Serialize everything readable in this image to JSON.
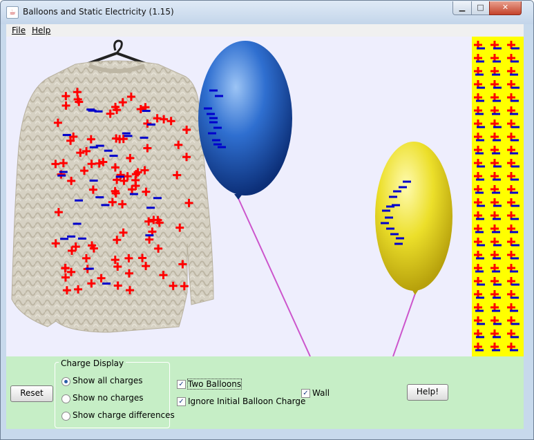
{
  "window": {
    "title": "Balloons and Static Electricity (1.15)",
    "controls": {
      "minimize": "▁",
      "maximize": "□",
      "close": "✕"
    }
  },
  "menu": {
    "file": "File",
    "help": "Help"
  },
  "controls": {
    "reset_label": "Reset",
    "charge_display": {
      "legend": "Charge Display",
      "options": [
        "Show all charges",
        "Show no charges",
        "Show charge differences"
      ],
      "selected": "Show all charges"
    },
    "two_balloons": {
      "label": "Two Balloons",
      "checked": true
    },
    "ignore_initial": {
      "label": "Ignore Initial Balloon Charge",
      "checked": true
    },
    "wall": {
      "label": "Wall",
      "checked": true
    },
    "help_label": "Help!"
  },
  "colors": {
    "positive_charge": "#ff0000",
    "negative_charge": "#0000cc",
    "blue_balloon": "#2f6fd0",
    "yellow_balloon": "#e8dc25",
    "wall": "#ffff00",
    "string": "#cc55cc",
    "sweater": "#d8d3c5",
    "panel": "#c6eec6"
  },
  "icons": {
    "app": "java-cup-icon",
    "check": "check-icon"
  }
}
